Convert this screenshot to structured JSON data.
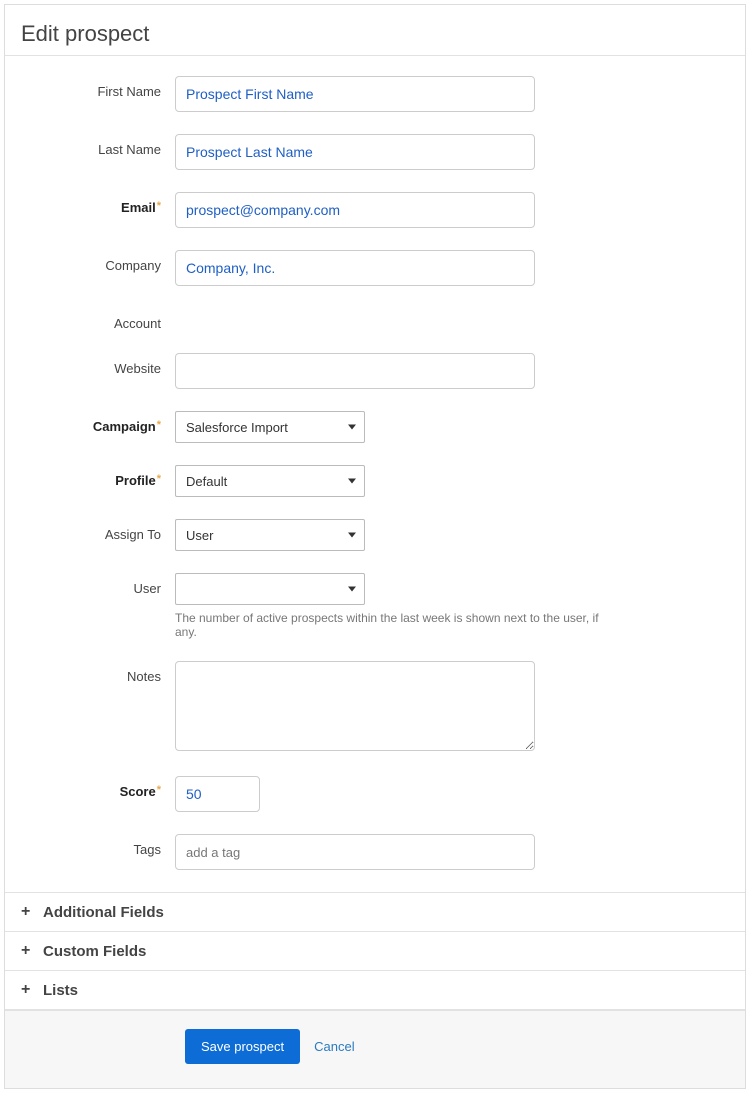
{
  "title": "Edit prospect",
  "labels": {
    "first_name": "First Name",
    "last_name": "Last Name",
    "email": "Email",
    "company": "Company",
    "account": "Account",
    "website": "Website",
    "campaign": "Campaign",
    "profile": "Profile",
    "assign_to": "Assign To",
    "user": "User",
    "notes": "Notes",
    "score": "Score",
    "tags": "Tags"
  },
  "values": {
    "first_name": "Prospect First Name",
    "last_name": "Prospect Last Name",
    "email": "prospect@company.com",
    "company": "Company, Inc.",
    "account": "",
    "website": "",
    "campaign": "Salesforce Import",
    "profile": "Default",
    "assign_to": "User",
    "user": "",
    "notes": "",
    "score": "50",
    "tags_placeholder": "add a tag"
  },
  "help": {
    "user": "The number of active prospects within the last week is shown next to the user, if any."
  },
  "accordions": {
    "additional": "Additional Fields",
    "custom": "Custom Fields",
    "lists": "Lists"
  },
  "footer": {
    "save": "Save prospect",
    "cancel": "Cancel"
  }
}
